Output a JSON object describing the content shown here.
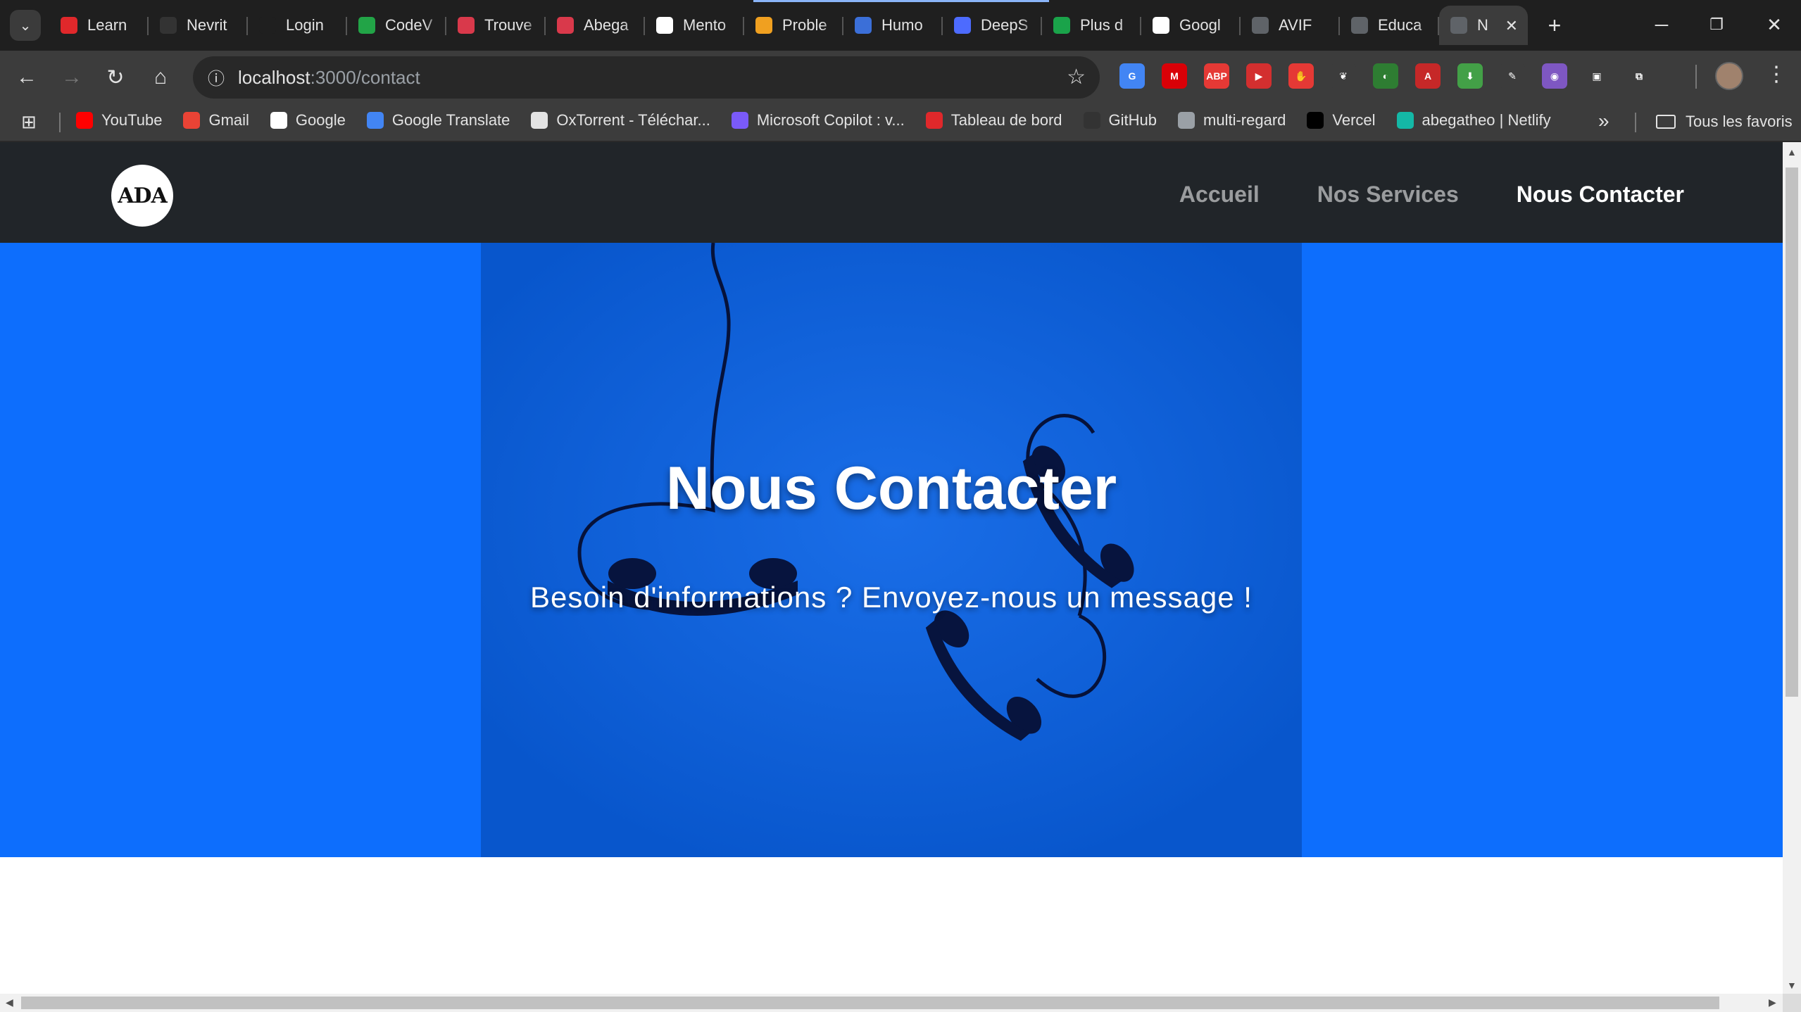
{
  "browser": {
    "tabs": [
      {
        "title": "Learn",
        "icon": "opera-icon",
        "color": "#e0282b"
      },
      {
        "title": "Nevrit",
        "icon": "github-icon",
        "color": "#333333"
      },
      {
        "title": "Login",
        "icon": "va-icon",
        "color": "#1f1f1f"
      },
      {
        "title": "CodeV",
        "icon": "plus-icon",
        "color": "#22a447"
      },
      {
        "title": "Trouve",
        "icon": "openai-icon",
        "color": "#d9394b"
      },
      {
        "title": "Abega",
        "icon": "openai-icon",
        "color": "#d9394b"
      },
      {
        "title": "Mento",
        "icon": "mentor-icon",
        "color": "#ffffff"
      },
      {
        "title": "Proble",
        "icon": "problem-icon",
        "color": "#f0a020"
      },
      {
        "title": "Humo",
        "icon": "humor-icon",
        "color": "#3b6fd8"
      },
      {
        "title": "DeepS",
        "icon": "deepseek-icon",
        "color": "#4d6bfe"
      },
      {
        "title": "Plus d",
        "icon": "px-icon",
        "color": "#1aa34a"
      },
      {
        "title": "Googl",
        "icon": "google-icon",
        "color": "#ffffff"
      },
      {
        "title": "AVIF",
        "icon": "globe-icon",
        "color": "#5f6368"
      },
      {
        "title": "Educa",
        "icon": "globe-icon",
        "color": "#5f6368"
      },
      {
        "title": "N",
        "icon": "globe-icon",
        "color": "#5f6368",
        "active": true
      }
    ],
    "close_tab_label": "✕",
    "new_tab_label": "+",
    "url_host": "localhost",
    "url_path": ":3000/contact",
    "bookmarks": [
      {
        "label": "YouTube",
        "icon": "youtube-icon",
        "color": "#ff0000"
      },
      {
        "label": "Gmail",
        "icon": "gmail-icon",
        "color": "#ea4335"
      },
      {
        "label": "Google",
        "icon": "google-icon",
        "color": "#ffffff"
      },
      {
        "label": "Google Translate",
        "icon": "translate-icon",
        "color": "#4285f4"
      },
      {
        "label": "OxTorrent - Téléchar...",
        "icon": "page-icon",
        "color": "#e3e3e3"
      },
      {
        "label": "Microsoft Copilot : v...",
        "icon": "copilot-icon",
        "color": "#7a5af8"
      },
      {
        "label": "Tableau de bord",
        "icon": "opera-icon",
        "color": "#e0282b"
      },
      {
        "label": "GitHub",
        "icon": "github-icon",
        "color": "#333333"
      },
      {
        "label": "multi-regard",
        "icon": "page-icon",
        "color": "#9aa0a6"
      },
      {
        "label": "Vercel",
        "icon": "vercel-icon",
        "color": "#000000"
      },
      {
        "label": "abegatheo | Netlify",
        "icon": "netlify-icon",
        "color": "#14b8a6"
      }
    ],
    "all_bookmarks_label": "Tous les favoris",
    "extensions": [
      {
        "name": "google-translate-ext-icon",
        "color": "#4285f4",
        "glyph": "G"
      },
      {
        "name": "mega-ext-icon",
        "color": "#d90007",
        "glyph": "M"
      },
      {
        "name": "adblock-plus-ext-icon",
        "color": "#e53935",
        "glyph": "ABP"
      },
      {
        "name": "video-ext-icon",
        "color": "#d32f2f",
        "glyph": "▶"
      },
      {
        "name": "adblock-hand-ext-icon",
        "color": "#e53935",
        "glyph": "✋"
      },
      {
        "name": "gnome-ext-icon",
        "color": "#3c3c3c",
        "glyph": "❦"
      },
      {
        "name": "color-ext-icon",
        "color": "#2e7d32",
        "glyph": "◐"
      },
      {
        "name": "pdf-ext-icon",
        "color": "#c62828",
        "glyph": "A"
      },
      {
        "name": "download-ext-icon",
        "color": "#43a047",
        "glyph": "⬇"
      },
      {
        "name": "eyedropper-ext-icon",
        "color": "#3c3c3c",
        "glyph": "✎"
      },
      {
        "name": "chrome-color-ext-icon",
        "color": "#7e57c2",
        "glyph": "◉"
      },
      {
        "name": "tab-ext-icon",
        "color": "#3c3c3c",
        "glyph": "▣"
      },
      {
        "name": "puzzle-ext-icon",
        "color": "#3c3c3c",
        "glyph": "⧉"
      }
    ]
  },
  "site": {
    "logo_text": "ADA",
    "nav": [
      {
        "label": "Accueil",
        "active": false
      },
      {
        "label": "Nos Services",
        "active": false
      },
      {
        "label": "Nous Contacter",
        "active": true
      }
    ],
    "hero_title": "Nous Contacter",
    "hero_subtitle": "Besoin d'informations ? Envoyez-nous un message !",
    "colors": {
      "primary": "#0d6efd",
      "navbar": "#212529",
      "hero_image": "#0b5fd6"
    }
  }
}
